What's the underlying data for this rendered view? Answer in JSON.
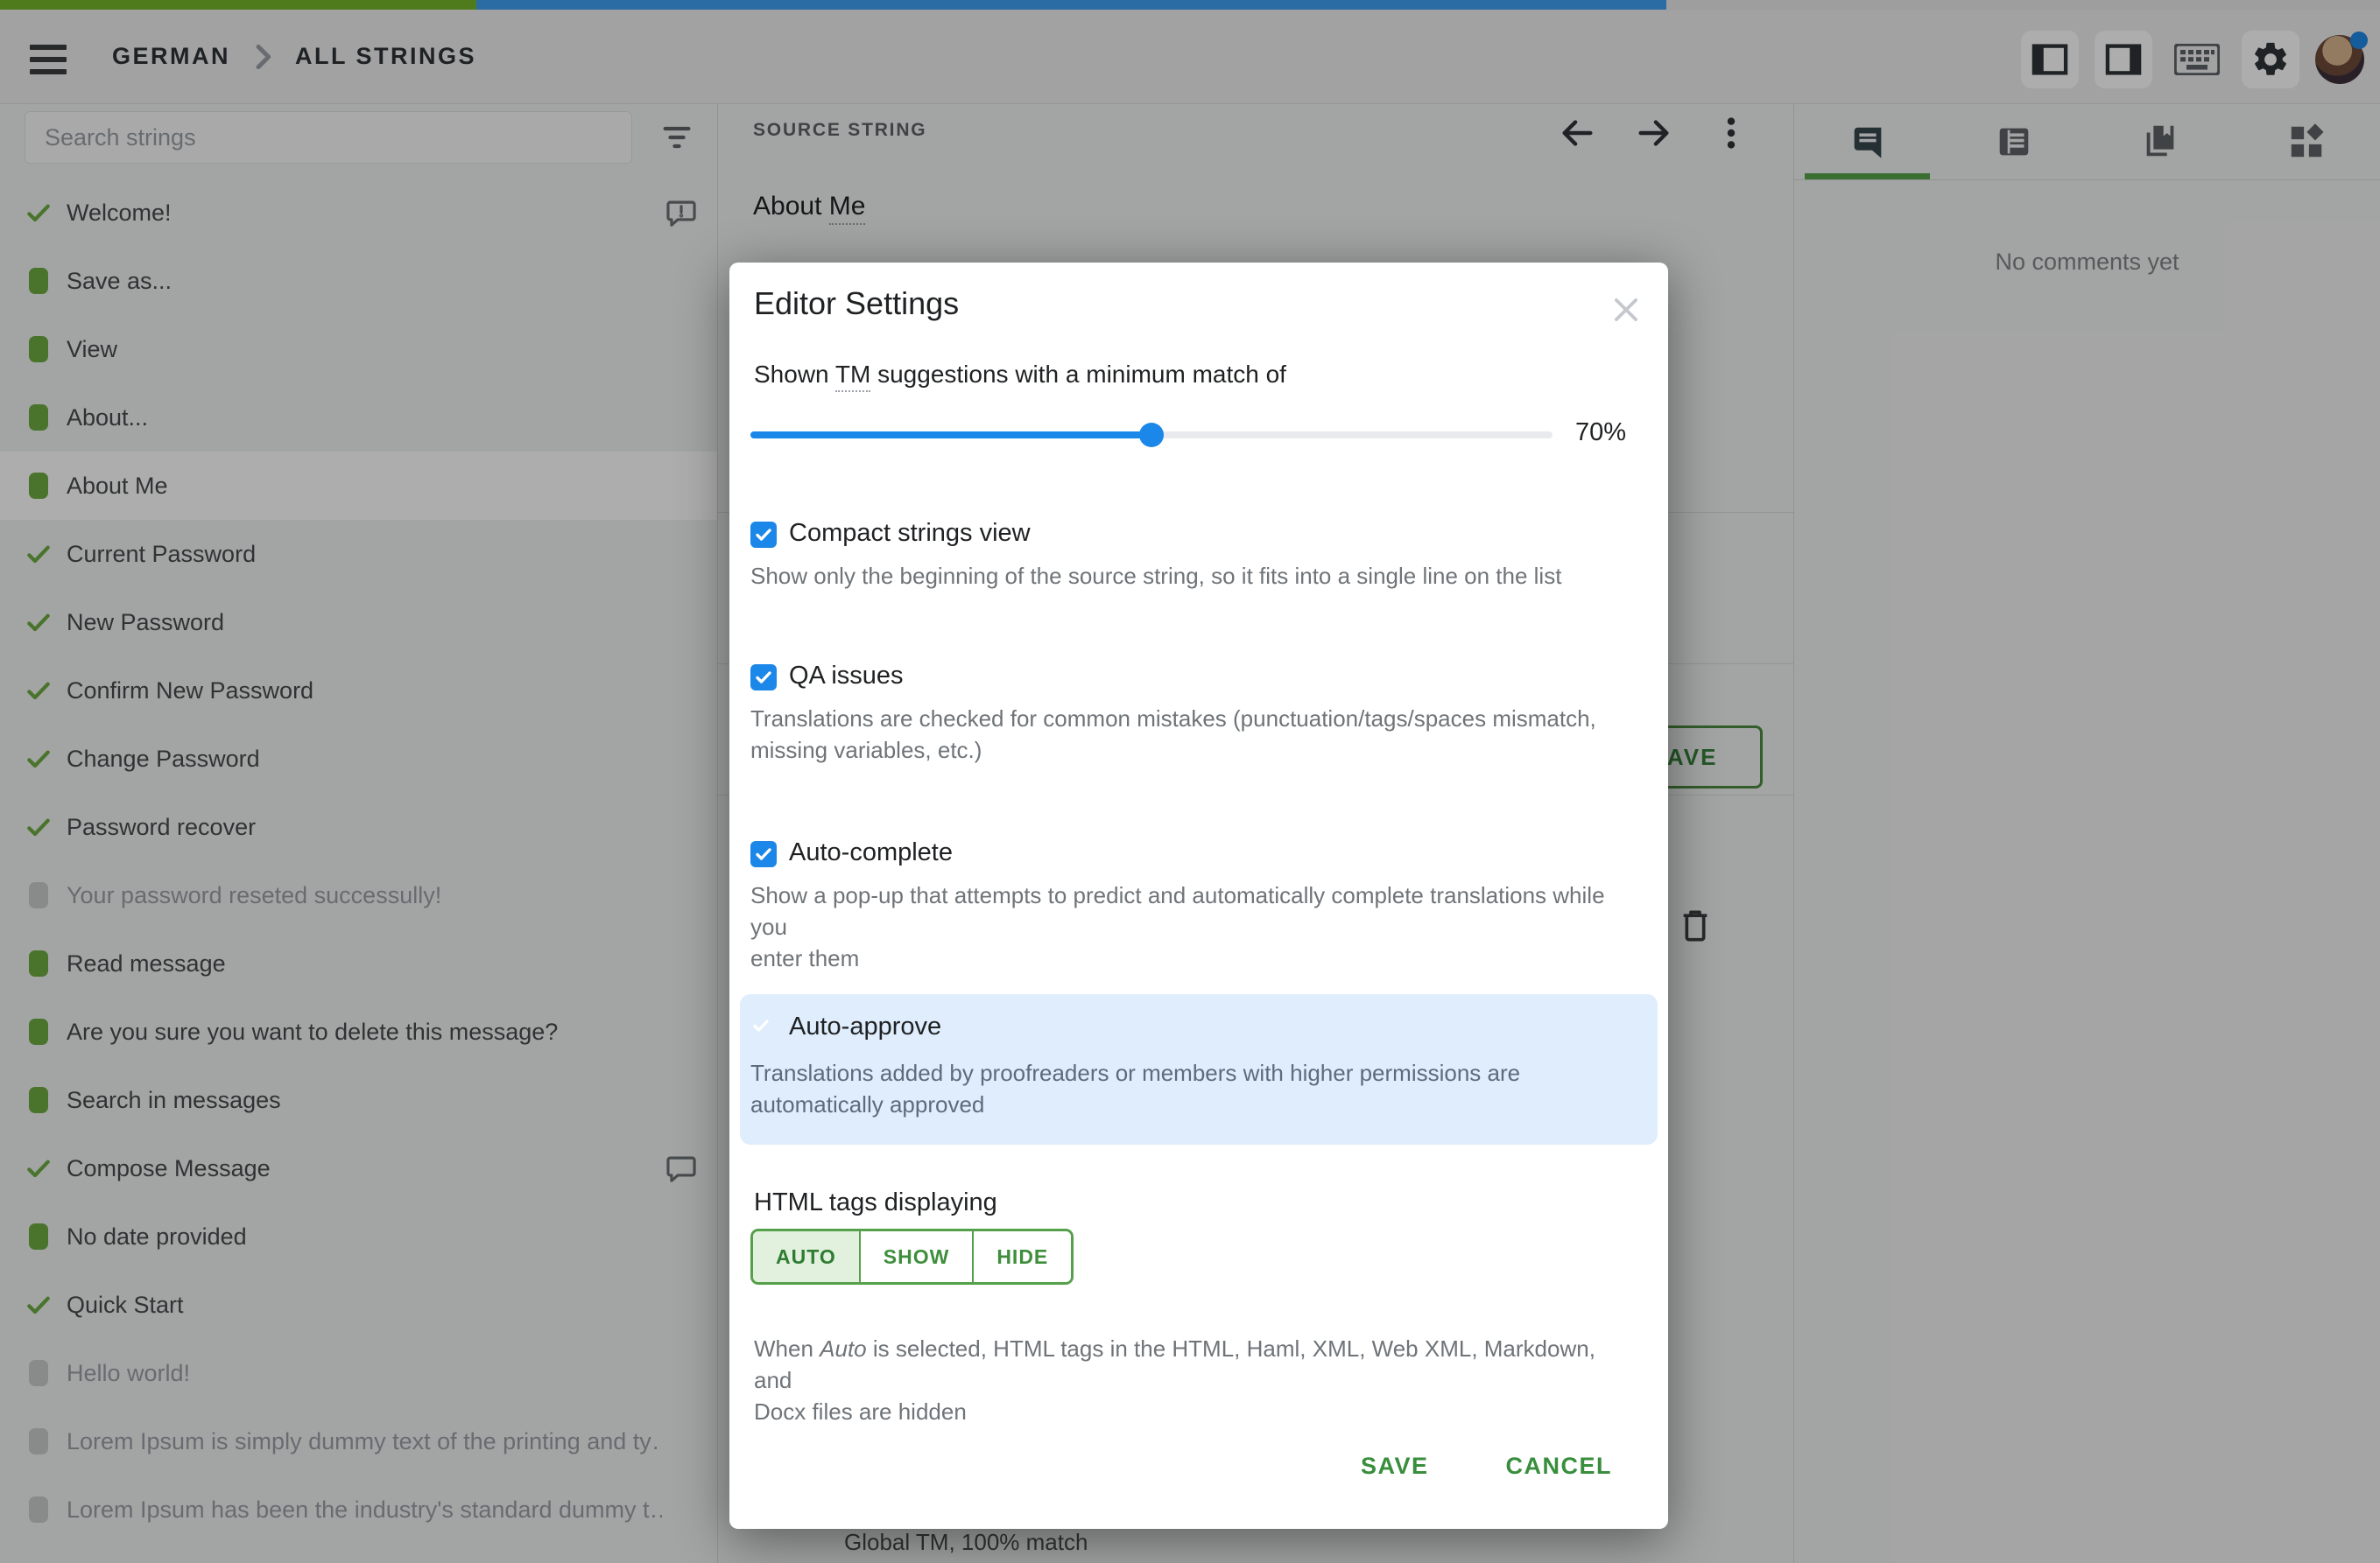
{
  "top_progress": {
    "approved_pct": 20,
    "translated_pct": 50
  },
  "header": {
    "breadcrumb": [
      "GERMAN",
      "ALL STRINGS"
    ],
    "icons": [
      "panel-left-icon",
      "panel-right-icon",
      "keyboard-icon",
      "gear-icon",
      "avatar"
    ],
    "avatar_status_color": "#1E88E5"
  },
  "sidebar": {
    "search_placeholder": "Search strings",
    "items": [
      {
        "label": "Welcome!",
        "status": "approved",
        "right_icon": "comment-issue"
      },
      {
        "label": "Save as...",
        "status": "translated"
      },
      {
        "label": "View",
        "status": "translated"
      },
      {
        "label": "About...",
        "status": "translated"
      },
      {
        "label": "About Me",
        "status": "translated",
        "selected": true
      },
      {
        "label": "Current Password",
        "status": "approved"
      },
      {
        "label": "New Password",
        "status": "approved"
      },
      {
        "label": "Confirm New Password",
        "status": "approved"
      },
      {
        "label": "Change Password",
        "status": "approved"
      },
      {
        "label": "Password recover",
        "status": "approved"
      },
      {
        "label": "Your password reseted successully!",
        "status": "untranslated"
      },
      {
        "label": "Read message",
        "status": "translated"
      },
      {
        "label": "Are you sure you want to delete this message?",
        "status": "translated"
      },
      {
        "label": "Search in messages",
        "status": "translated"
      },
      {
        "label": "Compose Message",
        "status": "approved",
        "right_icon": "comment"
      },
      {
        "label": "No date provided",
        "status": "translated"
      },
      {
        "label": "Quick Start",
        "status": "approved"
      },
      {
        "label": "Hello world!",
        "status": "untranslated"
      },
      {
        "label": "Lorem Ipsum is simply dummy text of the printing and ty…",
        "status": "untranslated"
      },
      {
        "label": "Lorem Ipsum has been the industry's standard dummy t…",
        "status": "untranslated"
      }
    ],
    "status_colors": {
      "approved": "#6DAB41",
      "translated": "#6DAB41",
      "untranslated": "#C9CDCB"
    }
  },
  "source_panel": {
    "header": "SOURCE STRING",
    "source_parts": [
      "About ",
      "Me"
    ],
    "save_button": "SAVE",
    "tm_match": "Global TM, 100% match"
  },
  "comments_panel": {
    "empty_text": "No comments yet"
  },
  "modal": {
    "title": "Editor Settings",
    "tm_parts": [
      "Shown ",
      "TM",
      " suggestions with a minimum match of"
    ],
    "slider": {
      "value_label": "70%",
      "percent": 50
    },
    "options": [
      {
        "label": "Compact strings view",
        "checked": true,
        "highlighted": false,
        "description": "Show only the beginning of the source string, so it fits into a single line on the list"
      },
      {
        "label": "QA issues",
        "checked": true,
        "highlighted": false,
        "description": "Translations are checked for common mistakes (punctuation/tags/spaces mismatch,\nmissing variables, etc.)"
      },
      {
        "label": "Auto-complete",
        "checked": true,
        "highlighted": false,
        "description": "Show a pop-up that attempts to predict and automatically complete translations while you\nenter them"
      },
      {
        "label": "Auto-approve",
        "checked": true,
        "highlighted": true,
        "description": "Translations added by proofreaders or members with higher permissions are\nautomatically approved"
      }
    ],
    "html_tags": {
      "label": "HTML tags displaying",
      "options": [
        "AUTO",
        "SHOW",
        "HIDE"
      ],
      "selected": "AUTO",
      "desc_parts": [
        "When ",
        "Auto",
        " is selected, HTML tags in the HTML, Haml, XML, Web XML, Markdown, and\nDocx files are hidden"
      ]
    },
    "save_label": "SAVE",
    "cancel_label": "CANCEL",
    "accent_green": "#388E3C",
    "accent_blue": "#1B87E8",
    "highlight_blue_bg": "#DFEDFC"
  }
}
